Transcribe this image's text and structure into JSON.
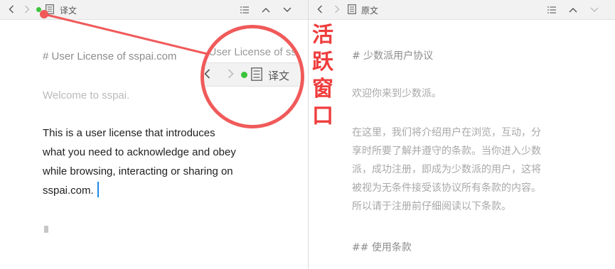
{
  "left_pane": {
    "title": "译文",
    "toolbar_icons": [
      "back-icon",
      "forward-icon",
      "document-icon",
      "list-icon",
      "chevron-up-icon",
      "chevron-down-icon"
    ],
    "heading": "# User License of sspai.com",
    "welcome": "Welcome to sspai.",
    "body_lines": [
      "This is a user license that introduces",
      "what you need to acknowledge and obey",
      "while browsing, interacting or sharing on",
      "sspai.com."
    ]
  },
  "right_pane": {
    "title": "原文",
    "toolbar_icons": [
      "back-icon",
      "forward-icon",
      "document-icon",
      "list-icon",
      "chevron-up-icon",
      "chevron-down-icon"
    ],
    "heading": "# 少数派用户协议",
    "welcome": "欢迎你来到少数派。",
    "body_lines": [
      "在这里，我们将介绍用户在浏览，互动，分",
      "享时所要了解并遵守的条款。当你进入少数",
      "派，成功注册，即成为少数派的用户，这将",
      "被视为无条件接受该协议所有条款的内容。",
      "所以请于注册前仔细阅读以下条款。"
    ],
    "subheading": "## 使用条款"
  },
  "callout": {
    "zoom_title": "译文",
    "zoom_heading": "# User License of sspai.com",
    "annotation_chars": [
      "活",
      "跃",
      "窗",
      "口"
    ],
    "accent_color": "#ef3d3d",
    "active_dot_color": "#3bc43b"
  }
}
